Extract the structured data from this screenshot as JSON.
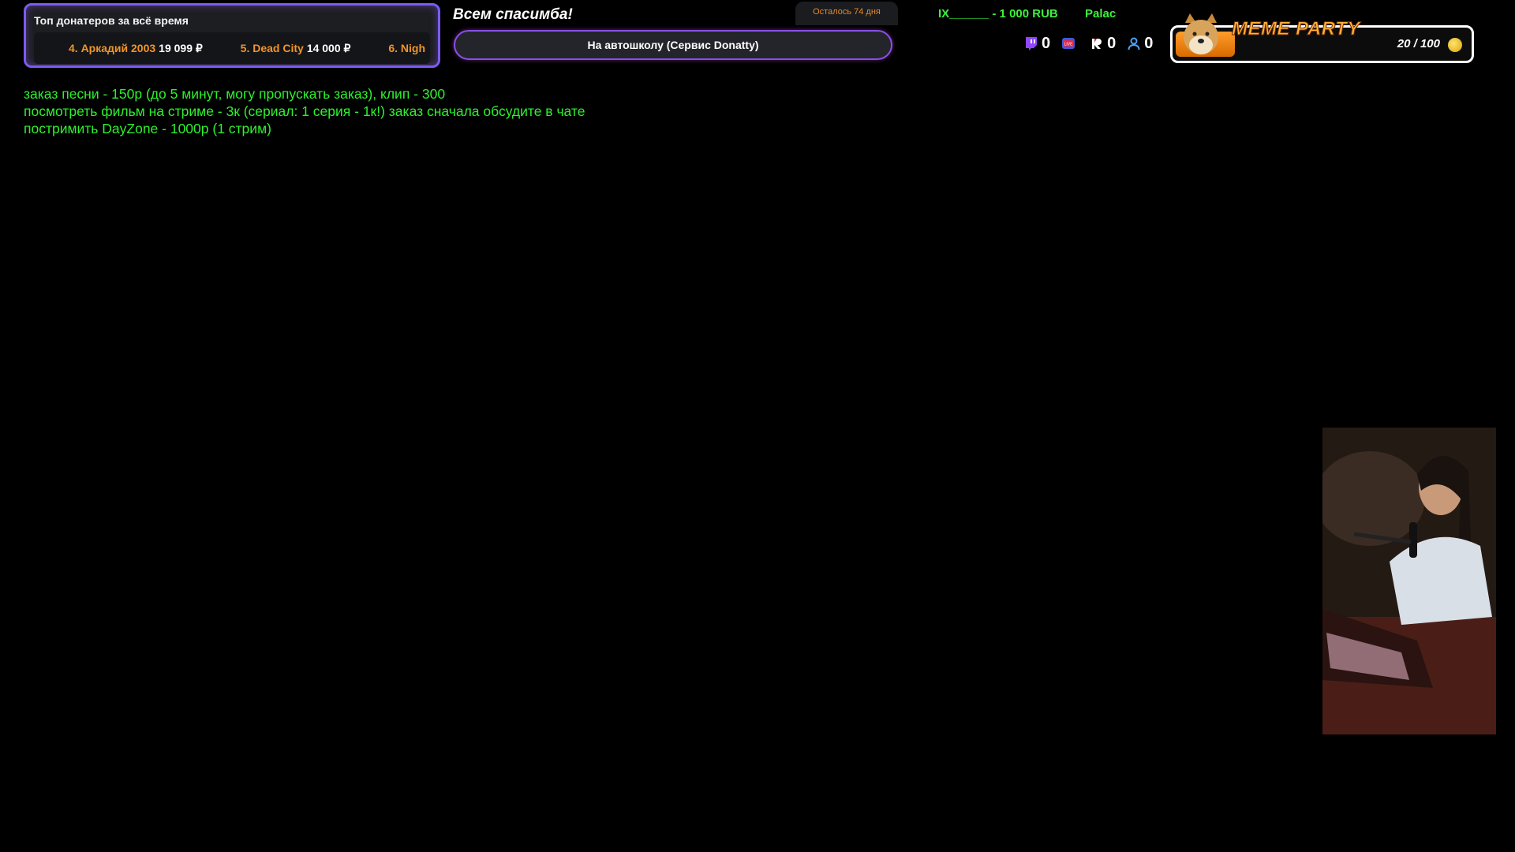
{
  "top_donors": {
    "title": "Топ донатеров за всё время",
    "items": [
      {
        "name": "4. Аркадий 2003",
        "amount": "19 099 ₽"
      },
      {
        "name": "5. Dead City",
        "amount": "14 000 ₽"
      },
      {
        "name": "6. Nigh",
        "amount": ""
      }
    ]
  },
  "goal": {
    "heading": "Всем спасимба!",
    "days_left": "Осталось 74 дня",
    "title": "На автошколу (Сервис Donatty)"
  },
  "ticker": {
    "item1": "IX______ - 1 000 RUB",
    "item2": "Palac"
  },
  "counters": [
    {
      "icon": "twitch-icon",
      "value": "0"
    },
    {
      "icon": "live-icon",
      "value": ""
    },
    {
      "icon": "r-icon",
      "value": "0"
    },
    {
      "icon": "viewers-icon",
      "value": "0"
    }
  ],
  "meme_party": {
    "title": "MEME PARTY",
    "count": "20 / 100",
    "progress": 0.2
  },
  "pricelist": [
    "заказ песни - 150р (до 5 минут, могу пропускать заказ), клип - 300",
    "посмотреть фильм на стриме - 3к (сериал: 1 серия - 1к!) заказ сначала обсудите в чате",
    "постримить DayZone - 1000р (1 стрим)"
  ],
  "colors": {
    "accent_green": "#2ef02e",
    "donor_orange": "#f0952a",
    "panel_border": "#7a5cf0"
  }
}
